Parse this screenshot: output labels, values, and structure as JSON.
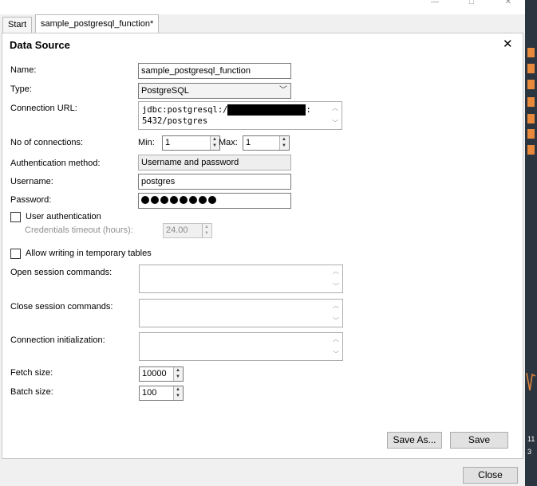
{
  "tabs": [
    {
      "label": "Start"
    },
    {
      "label": "sample_postgresql_function*"
    }
  ],
  "panel": {
    "title": "Data Source",
    "close_glyph": "✕"
  },
  "form": {
    "name_label": "Name:",
    "name_value": "sample_postgresql_function",
    "type_label": "Type:",
    "type_value": "PostgreSQL",
    "url_label": "Connection URL:",
    "url_line1_prefix": "jdbc:postgresql:/",
    "url_line1_suffix": ":",
    "url_line2": "5432/postgres",
    "connections_label": "No of connections:",
    "min_label": "Min:",
    "min_value": "1",
    "max_label": "Max:",
    "max_value": "1",
    "auth_label": "Authentication method:",
    "auth_value": "Username and password",
    "username_label": "Username:",
    "username_value": "postgres",
    "password_label": "Password:",
    "password_length": 8,
    "user_auth_label": "User authentication",
    "user_auth_checked": false,
    "cred_timeout_label": "Credentials timeout (hours):",
    "cred_timeout_value": "24.00",
    "allow_temp_label": "Allow writing in temporary tables",
    "allow_temp_checked": false,
    "open_session_label": "Open session commands:",
    "close_session_label": "Close session commands:",
    "conn_init_label": "Connection initialization:",
    "fetch_label": "Fetch size:",
    "fetch_value": "10000",
    "batch_label": "Batch size:",
    "batch_value": "100"
  },
  "buttons": {
    "save_as": "Save As...",
    "save": "Save",
    "close": "Close"
  },
  "side_strip": {
    "line1": "11",
    "line2": "3"
  },
  "icons": {
    "window_minimize": "minimize-icon",
    "window_maximize": "maximize-icon",
    "window_close": "window-close-icon",
    "select_arrow": "chevron-down-icon"
  }
}
